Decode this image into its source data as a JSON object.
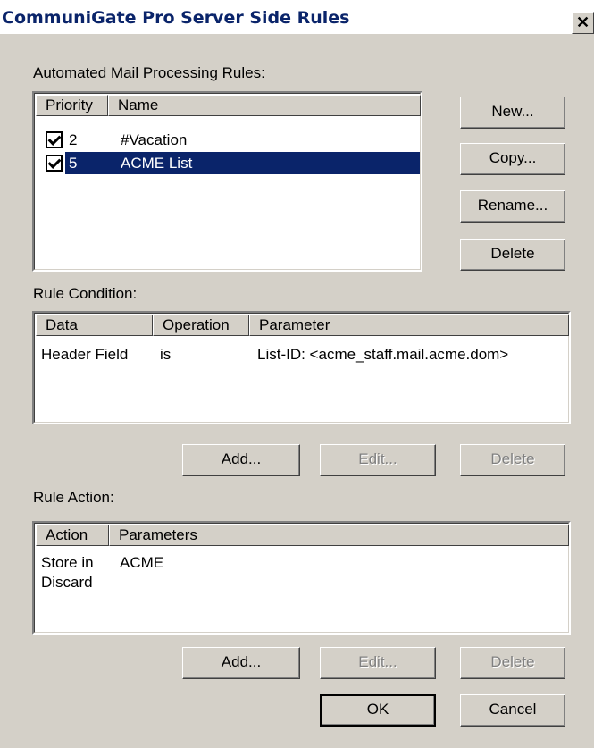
{
  "window": {
    "title": "CommuniGate Pro Server Side Rules",
    "close_symbol": "✕"
  },
  "rules": {
    "label": "Automated Mail Processing Rules:",
    "columns": [
      "Priority",
      "Name"
    ],
    "items": [
      {
        "enabled": true,
        "priority": "2",
        "name": "#Vacation",
        "selected": false
      },
      {
        "enabled": true,
        "priority": "5",
        "name": "ACME List",
        "selected": true
      }
    ],
    "buttons": {
      "new": "New...",
      "copy": "Copy...",
      "rename": "Rename...",
      "delete": "Delete"
    }
  },
  "condition": {
    "label": "Rule Condition:",
    "columns": [
      "Data",
      "Operation",
      "Parameter"
    ],
    "rows": [
      {
        "data": "Header Field",
        "operation": "is",
        "parameter": "List-ID: <acme_staff.mail.acme.dom>"
      }
    ],
    "buttons": {
      "add": "Add...",
      "edit": "Edit...",
      "delete": "Delete"
    }
  },
  "action": {
    "label": "Rule Action:",
    "columns": [
      "Action",
      "Parameters"
    ],
    "rows": [
      {
        "action": "Store in",
        "parameters": "ACME"
      },
      {
        "action": "Discard",
        "parameters": ""
      }
    ],
    "buttons": {
      "add": "Add...",
      "edit": "Edit...",
      "delete": "Delete"
    }
  },
  "footer": {
    "ok": "OK",
    "cancel": "Cancel"
  },
  "colors": {
    "face": "#d4d0c8",
    "selection": "#0a246a",
    "title_text": "#0a246a"
  }
}
